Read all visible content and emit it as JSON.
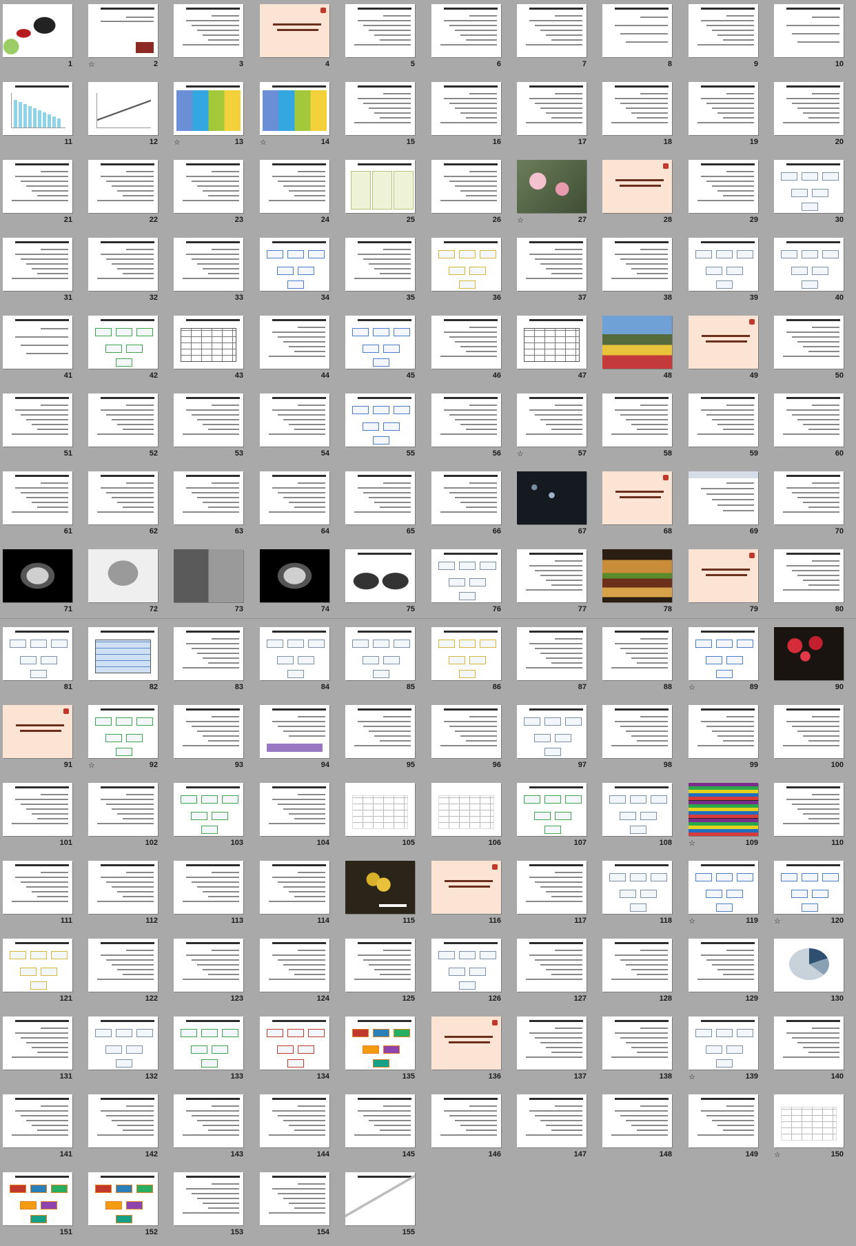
{
  "slides": [
    {
      "n": "1",
      "style": "calligraphy",
      "star": false
    },
    {
      "n": "2",
      "style": "title-image",
      "star": true
    },
    {
      "n": "3",
      "style": "text",
      "star": false
    },
    {
      "n": "4",
      "style": "accent",
      "star": false
    },
    {
      "n": "5",
      "style": "text",
      "star": false
    },
    {
      "n": "6",
      "style": "text",
      "star": false
    },
    {
      "n": "7",
      "style": "text",
      "star": false
    },
    {
      "n": "8",
      "style": "text-light",
      "star": false
    },
    {
      "n": "9",
      "style": "text",
      "star": false
    },
    {
      "n": "10",
      "style": "text-light",
      "star": false
    },
    {
      "n": "11",
      "style": "chart-bar",
      "star": false
    },
    {
      "n": "12",
      "style": "chart-line",
      "star": false
    },
    {
      "n": "13",
      "style": "cols",
      "star": true
    },
    {
      "n": "14",
      "style": "cols",
      "star": true
    },
    {
      "n": "15",
      "style": "text",
      "star": false
    },
    {
      "n": "16",
      "style": "text",
      "star": false
    },
    {
      "n": "17",
      "style": "text",
      "star": false
    },
    {
      "n": "18",
      "style": "text",
      "star": false
    },
    {
      "n": "19",
      "style": "text",
      "star": false
    },
    {
      "n": "20",
      "style": "text",
      "star": false
    },
    {
      "n": "21",
      "style": "text",
      "star": false
    },
    {
      "n": "22",
      "style": "text",
      "star": false
    },
    {
      "n": "23",
      "style": "text",
      "star": false
    },
    {
      "n": "24",
      "style": "text",
      "star": false
    },
    {
      "n": "25",
      "style": "text-boxes",
      "star": false
    },
    {
      "n": "26",
      "style": "text",
      "star": false
    },
    {
      "n": "27",
      "style": "photo-blossom",
      "star": true
    },
    {
      "n": "28",
      "style": "accent",
      "star": false
    },
    {
      "n": "29",
      "style": "text",
      "star": false
    },
    {
      "n": "30",
      "style": "diagram",
      "star": false
    },
    {
      "n": "31",
      "style": "text",
      "star": false
    },
    {
      "n": "32",
      "style": "text",
      "star": false
    },
    {
      "n": "33",
      "style": "text",
      "star": false
    },
    {
      "n": "34",
      "style": "diagram-blue",
      "star": false
    },
    {
      "n": "35",
      "style": "text",
      "star": false
    },
    {
      "n": "36",
      "style": "diagram-yellow",
      "star": false
    },
    {
      "n": "37",
      "style": "text",
      "star": false
    },
    {
      "n": "38",
      "style": "text",
      "star": false
    },
    {
      "n": "39",
      "style": "diagram",
      "star": false
    },
    {
      "n": "40",
      "style": "diagram",
      "star": false
    },
    {
      "n": "41",
      "style": "text-light",
      "star": false
    },
    {
      "n": "42",
      "style": "diagram-green",
      "star": false
    },
    {
      "n": "43",
      "style": "table",
      "star": false
    },
    {
      "n": "44",
      "style": "text",
      "star": false
    },
    {
      "n": "45",
      "style": "diagram-blue",
      "star": false
    },
    {
      "n": "46",
      "style": "text",
      "star": false
    },
    {
      "n": "47",
      "style": "table",
      "star": false
    },
    {
      "n": "48",
      "style": "photo-tulips",
      "star": false
    },
    {
      "n": "49",
      "style": "accent",
      "star": false
    },
    {
      "n": "50",
      "style": "text",
      "star": false
    },
    {
      "n": "51",
      "style": "text",
      "star": false
    },
    {
      "n": "52",
      "style": "text",
      "star": false
    },
    {
      "n": "53",
      "style": "text",
      "star": false
    },
    {
      "n": "54",
      "style": "text",
      "star": false
    },
    {
      "n": "55",
      "style": "diagram-blue",
      "star": false
    },
    {
      "n": "56",
      "style": "text",
      "star": false
    },
    {
      "n": "57",
      "style": "text",
      "star": true
    },
    {
      "n": "58",
      "style": "text",
      "star": false
    },
    {
      "n": "59",
      "style": "text",
      "star": false
    },
    {
      "n": "60",
      "style": "text",
      "star": false
    },
    {
      "n": "61",
      "style": "text",
      "star": false
    },
    {
      "n": "62",
      "style": "text",
      "star": false
    },
    {
      "n": "63",
      "style": "text",
      "star": false
    },
    {
      "n": "64",
      "style": "text",
      "star": false
    },
    {
      "n": "65",
      "style": "text",
      "star": false
    },
    {
      "n": "66",
      "style": "text",
      "star": false
    },
    {
      "n": "67",
      "style": "photo-dark",
      "star": false
    },
    {
      "n": "68",
      "style": "accent",
      "star": false
    },
    {
      "n": "69",
      "style": "screenshot",
      "star": false
    },
    {
      "n": "70",
      "style": "text",
      "star": false
    },
    {
      "n": "71",
      "style": "photo-ct",
      "star": false
    },
    {
      "n": "72",
      "style": "photo-mri",
      "star": false
    },
    {
      "n": "73",
      "style": "screenshot-gray",
      "star": false
    },
    {
      "n": "74",
      "style": "photo-ct",
      "star": false
    },
    {
      "n": "75",
      "style": "photo-xray",
      "star": false
    },
    {
      "n": "76",
      "style": "diagram",
      "star": false
    },
    {
      "n": "77",
      "style": "text",
      "star": false
    },
    {
      "n": "78",
      "style": "photo-burger",
      "star": false
    },
    {
      "n": "79",
      "style": "accent",
      "star": false
    },
    {
      "n": "80",
      "style": "text",
      "star": false
    },
    {
      "n": "81",
      "style": "diagram",
      "star": false
    },
    {
      "n": "82",
      "style": "table-blue",
      "star": false
    },
    {
      "n": "83",
      "style": "text",
      "star": false
    },
    {
      "n": "84",
      "style": "diagram",
      "star": false
    },
    {
      "n": "85",
      "style": "diagram",
      "star": false
    },
    {
      "n": "86",
      "style": "diagram-yellow",
      "star": false
    },
    {
      "n": "87",
      "style": "text",
      "star": false
    },
    {
      "n": "88",
      "style": "text",
      "star": false
    },
    {
      "n": "89",
      "style": "diagram-blue",
      "star": true
    },
    {
      "n": "90",
      "style": "photo-flowers",
      "star": false
    },
    {
      "n": "91",
      "style": "accent",
      "star": false
    },
    {
      "n": "92",
      "style": "diagram-green",
      "star": true
    },
    {
      "n": "93",
      "style": "text",
      "star": false
    },
    {
      "n": "94",
      "style": "text-purple",
      "star": false
    },
    {
      "n": "95",
      "style": "text",
      "star": false
    },
    {
      "n": "96",
      "style": "text",
      "star": false
    },
    {
      "n": "97",
      "style": "diagram",
      "star": false
    },
    {
      "n": "98",
      "style": "text",
      "star": false
    },
    {
      "n": "99",
      "style": "text",
      "star": false
    },
    {
      "n": "100",
      "style": "text",
      "star": false
    },
    {
      "n": "101",
      "style": "text",
      "star": false
    },
    {
      "n": "102",
      "style": "text",
      "star": false
    },
    {
      "n": "103",
      "style": "diagram-green",
      "star": false
    },
    {
      "n": "104",
      "style": "text",
      "star": false
    },
    {
      "n": "105",
      "style": "table-light",
      "star": false
    },
    {
      "n": "106",
      "style": "table-light",
      "star": false
    },
    {
      "n": "107",
      "style": "diagram-green",
      "star": false
    },
    {
      "n": "108",
      "style": "diagram",
      "star": false
    },
    {
      "n": "109",
      "style": "color-table",
      "star": true
    },
    {
      "n": "110",
      "style": "text",
      "star": false
    },
    {
      "n": "111",
      "style": "text",
      "star": false
    },
    {
      "n": "112",
      "style": "text",
      "star": false
    },
    {
      "n": "113",
      "style": "text",
      "star": false
    },
    {
      "n": "114",
      "style": "text",
      "star": false
    },
    {
      "n": "115",
      "style": "photo-thanks",
      "star": false
    },
    {
      "n": "116",
      "style": "accent",
      "star": false
    },
    {
      "n": "117",
      "style": "text",
      "star": false
    },
    {
      "n": "118",
      "style": "diagram",
      "star": false
    },
    {
      "n": "119",
      "style": "diagram-blue",
      "star": true
    },
    {
      "n": "120",
      "style": "diagram-blue",
      "star": true
    },
    {
      "n": "121",
      "style": "diagram-yellow",
      "star": false
    },
    {
      "n": "122",
      "style": "text",
      "star": false
    },
    {
      "n": "123",
      "style": "text",
      "star": false
    },
    {
      "n": "124",
      "style": "text",
      "star": false
    },
    {
      "n": "125",
      "style": "text",
      "star": false
    },
    {
      "n": "126",
      "style": "diagram",
      "star": false
    },
    {
      "n": "127",
      "style": "text",
      "star": false
    },
    {
      "n": "128",
      "style": "text",
      "star": false
    },
    {
      "n": "129",
      "style": "text",
      "star": false
    },
    {
      "n": "130",
      "style": "chart-pie",
      "star": false
    },
    {
      "n": "131",
      "style": "text",
      "star": false
    },
    {
      "n": "132",
      "style": "diagram",
      "star": false
    },
    {
      "n": "133",
      "style": "diagram-green",
      "star": false
    },
    {
      "n": "134",
      "style": "diagram-red",
      "star": false
    },
    {
      "n": "135",
      "style": "diagram-color",
      "star": false
    },
    {
      "n": "136",
      "style": "accent",
      "star": false
    },
    {
      "n": "137",
      "style": "text",
      "star": false
    },
    {
      "n": "138",
      "style": "text",
      "star": false
    },
    {
      "n": "139",
      "style": "diagram",
      "star": true
    },
    {
      "n": "140",
      "style": "text",
      "star": false
    },
    {
      "n": "141",
      "style": "text",
      "star": false
    },
    {
      "n": "142",
      "style": "text",
      "star": false
    },
    {
      "n": "143",
      "style": "text",
      "star": false
    },
    {
      "n": "144",
      "style": "text",
      "star": false
    },
    {
      "n": "145",
      "style": "text",
      "star": false
    },
    {
      "n": "146",
      "style": "text",
      "star": false
    },
    {
      "n": "147",
      "style": "text",
      "star": false
    },
    {
      "n": "148",
      "style": "text",
      "star": false
    },
    {
      "n": "149",
      "style": "text",
      "star": false
    },
    {
      "n": "150",
      "style": "table-light",
      "star": true
    },
    {
      "n": "151",
      "style": "diagram-color",
      "star": false
    },
    {
      "n": "152",
      "style": "diagram-color",
      "star": false
    },
    {
      "n": "153",
      "style": "text",
      "star": false
    },
    {
      "n": "154",
      "style": "text",
      "star": false
    },
    {
      "n": "155",
      "style": "photo-end",
      "star": false
    }
  ],
  "star_glyph": "☆"
}
